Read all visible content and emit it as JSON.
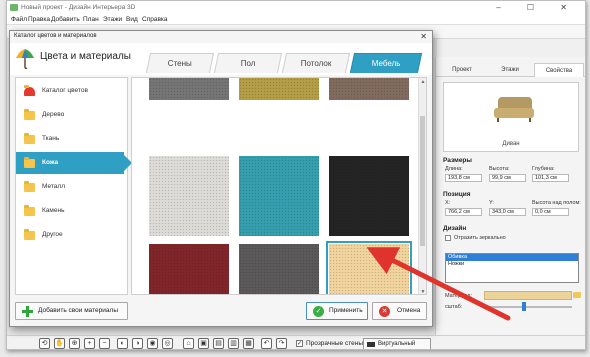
{
  "app": {
    "title": "Новый проект - Дизайн Интерьера 3D",
    "window_controls": "– ☐ ✕"
  },
  "menu": [
    "Файл",
    "Правка",
    "Добавить",
    "План",
    "Этажи",
    "Вид",
    "Справка"
  ],
  "right_panel": {
    "tabs": [
      "Проект",
      "Этажи",
      "Свойства"
    ],
    "preview_label": "Диван",
    "sizes": {
      "title": "Размеры",
      "fields": [
        {
          "label": "Длина:",
          "value": "193,8 см"
        },
        {
          "label": "Высота:",
          "value": "99,9 см"
        },
        {
          "label": "Глубина:",
          "value": "101,3 см"
        }
      ]
    },
    "position": {
      "title": "Позиция",
      "fields": [
        {
          "label": "X:",
          "value": "766,2 см"
        },
        {
          "label": "Y:",
          "value": "343,0 см"
        },
        {
          "label": "Высота над полом:",
          "value": "0,0 см"
        }
      ]
    },
    "design": {
      "title": "Дизайн",
      "mirror_label": "Отразить зеркально",
      "items": [
        "Обивка",
        "Ножки"
      ],
      "material_label": "Материал:",
      "scale_label": "сштаб:",
      "material_color": "#ecd39a"
    }
  },
  "bottom_bar": {
    "transparent_walls": "Прозрачные стены",
    "virtual_visit": "Виртуальный визит"
  },
  "dialog": {
    "title": "Каталог цветов и материалов",
    "close": "✕",
    "heading": "Цвета и материалы",
    "tabs": [
      "Стены",
      "Пол",
      "Потолок",
      "Мебель"
    ],
    "active_tab": 3,
    "categories": [
      {
        "label": "Каталог цветов",
        "icon": "umbrella-icon"
      },
      {
        "label": "Дерево",
        "icon": "folder-icon"
      },
      {
        "label": "Ткань",
        "icon": "folder-icon"
      },
      {
        "label": "Кожа",
        "icon": "folder-icon"
      },
      {
        "label": "Металл",
        "icon": "folder-icon"
      },
      {
        "label": "Камень",
        "icon": "folder-icon"
      },
      {
        "label": "Другое",
        "icon": "folder-icon"
      }
    ],
    "active_category": 3,
    "swatches": [
      "#707070",
      "#b19a3f",
      "#7c6658",
      "#dcdad6",
      "#2e9cac",
      "#1d1d1d",
      "#7c1e22",
      "#555354",
      "#f0d29a"
    ],
    "selected_swatch": 8,
    "add_button": "Добавить свои материалы",
    "apply_button": "Применить",
    "cancel_button": "Отмена"
  }
}
